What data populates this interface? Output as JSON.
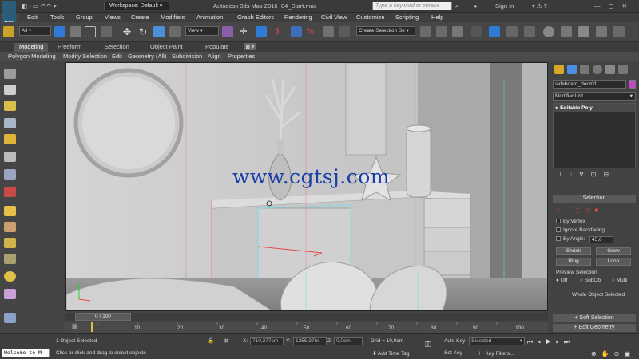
{
  "app": {
    "title": "Autodesk 3ds Max 2016",
    "file": "04_Start.max",
    "logo": "MAX",
    "workspace": "Workspace: Default",
    "search_placeholder": "Type a keyword or phrase",
    "sign_in": "Sign In"
  },
  "menu": [
    "Edit",
    "Tools",
    "Group",
    "Views",
    "Create",
    "Modifiers",
    "Animation",
    "Graph Editors",
    "Rendering",
    "Civil View",
    "Customize",
    "Scripting",
    "Help"
  ],
  "toolbar": {
    "filter": "All",
    "ref_coord": "View",
    "selection_set": "Create Selection Se"
  },
  "ribbon": {
    "tabs": [
      "Modeling",
      "Freeform",
      "Selection",
      "Object Paint",
      "Populate"
    ],
    "subtabs": [
      "Polygon Modeling",
      "Modify Selection",
      "Edit",
      "Geometry (All)",
      "Subdivision",
      "Align",
      "Properties"
    ]
  },
  "viewport": {
    "watermark": "www.cgtsj.com"
  },
  "command_panel": {
    "object_name": "sideboard_door01",
    "modifier_list": "Modifier List",
    "stack_item": "Editable Poly",
    "selection_title": "Selection",
    "by_vertex": "By Vertex",
    "ignore_backfacing": "Ignore Backfacing",
    "by_angle": "By Angle:",
    "angle_value": "45,0",
    "shrink": "Shrink",
    "grow": "Grow",
    "ring": "Ring",
    "loop": "Loop",
    "preview_selection": "Preview Selection",
    "preview_off": "Off",
    "preview_subobj": "SubObj",
    "preview_multi": "Multi",
    "whole_object": "Whole Object Selected",
    "soft_selection": "Soft Selection",
    "edit_geometry": "Edit Geometry"
  },
  "timeline": {
    "frame_counter": "0 / 100",
    "ticks": [
      "10",
      "20",
      "30",
      "40",
      "50",
      "60",
      "70",
      "80",
      "90",
      "100"
    ]
  },
  "status": {
    "objects_selected": "1 Object Selected",
    "hint": "Click or click-and-drag to select objects",
    "x_label": "X:",
    "x_value": "710,277cm",
    "y_label": "Y:",
    "y_value": "1255,376c",
    "z_label": "Z:",
    "z_value": "0,0cm",
    "grid": "Grid = 10,0cm",
    "add_time_tag": "Add Time Tag",
    "auto_key": "Auto Key",
    "set_key": "Set Key",
    "key_mode": "Selected",
    "key_filters": "Key Filters...",
    "maxscript": "Welcome to M"
  },
  "colors": {
    "accent_blue": "#2b5c7a",
    "watermark": "#1b3fa8",
    "selection_pink": "#e07aa0",
    "selection_cyan": "#7fd9e8"
  }
}
